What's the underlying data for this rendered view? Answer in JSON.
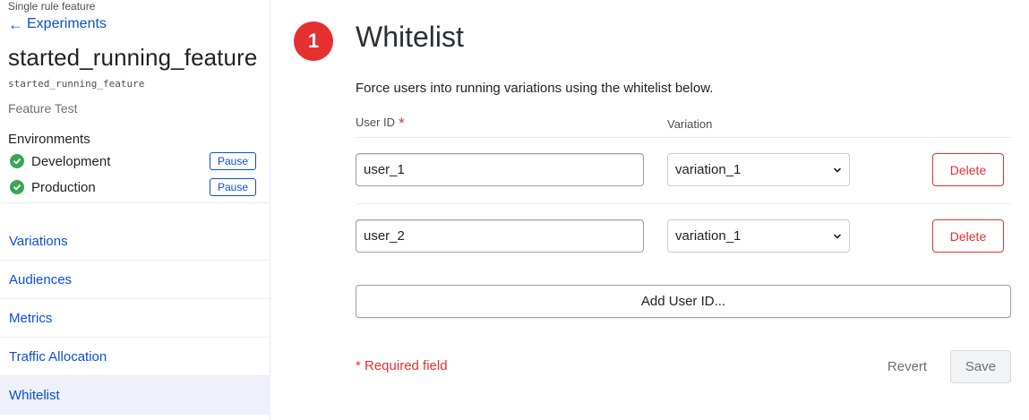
{
  "sidebar": {
    "crumb": "Single rule feature",
    "back_label": "Experiments",
    "flag_title": "started_running_feature",
    "flag_key": "started_running_feature",
    "flag_type": "Feature Test",
    "environments_heading": "Environments",
    "environments": [
      {
        "name": "Development",
        "action_label": "Pause"
      },
      {
        "name": "Production",
        "action_label": "Pause"
      }
    ],
    "nav": [
      {
        "label": "Variations"
      },
      {
        "label": "Audiences"
      },
      {
        "label": "Metrics"
      },
      {
        "label": "Traffic Allocation"
      },
      {
        "label": "Whitelist",
        "active": true
      }
    ]
  },
  "main": {
    "step_number": "1",
    "title": "Whitelist",
    "description": "Force users into running variations using the whitelist below.",
    "columns": {
      "user_id": "User ID",
      "required_mark": "*",
      "variation": "Variation"
    },
    "rows": [
      {
        "user_id": "user_1",
        "variation": "variation_1",
        "delete_label": "Delete"
      },
      {
        "user_id": "user_2",
        "variation": "variation_1",
        "delete_label": "Delete"
      }
    ],
    "add_label": "Add User ID...",
    "required_note": "* Required field",
    "revert_label": "Revert",
    "save_label": "Save"
  },
  "icons": {
    "back": "arrow-left-icon",
    "env_status": "check-circle-icon",
    "select": "chevron-down-icon"
  },
  "colors": {
    "link": "#0b4fd6",
    "danger": "#e62f2f",
    "success": "#3aa655",
    "active_nav_bg": "#eef1fb"
  }
}
